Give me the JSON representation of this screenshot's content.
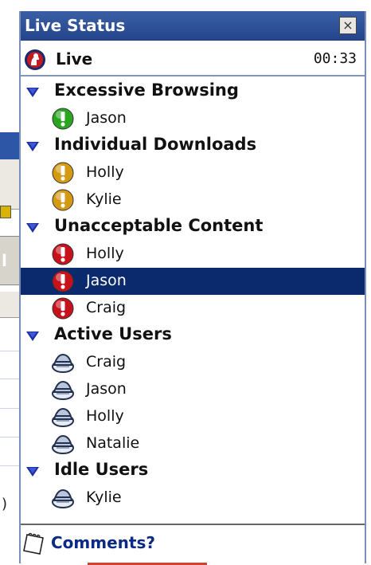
{
  "panel": {
    "title": "Live Status",
    "close_glyph": "×",
    "live_label": "Live",
    "live_time": "00:33"
  },
  "groups": [
    {
      "label": "Excessive Browsing",
      "items": [
        {
          "label": "Jason",
          "icon": "alert-green-icon"
        }
      ]
    },
    {
      "label": "Individual Downloads",
      "items": [
        {
          "label": "Holly",
          "icon": "alert-yellow-icon"
        },
        {
          "label": "Kylie",
          "icon": "alert-yellow-icon"
        }
      ]
    },
    {
      "label": "Unacceptable Content",
      "items": [
        {
          "label": "Holly",
          "icon": "alert-red-icon"
        },
        {
          "label": "Jason",
          "icon": "alert-red-icon",
          "selected": true
        },
        {
          "label": "Craig",
          "icon": "alert-red-icon"
        }
      ]
    },
    {
      "label": "Active Users",
      "items": [
        {
          "label": "Craig",
          "icon": "user-hat-icon"
        },
        {
          "label": "Jason",
          "icon": "user-hat-icon"
        },
        {
          "label": "Holly",
          "icon": "user-hat-icon"
        },
        {
          "label": "Natalie",
          "icon": "user-hat-icon"
        }
      ]
    },
    {
      "label": "Idle Users",
      "items": [
        {
          "label": "Kylie",
          "icon": "user-hat-icon"
        }
      ]
    }
  ],
  "footer": {
    "comments_label": "Comments?"
  },
  "background": {
    "paren": ")"
  },
  "colors": {
    "titlebar": "#2b4c92",
    "selection": "#0b2a6e",
    "alert_green": "#2aa520",
    "alert_yellow": "#d39a12",
    "alert_red": "#c8121b"
  }
}
